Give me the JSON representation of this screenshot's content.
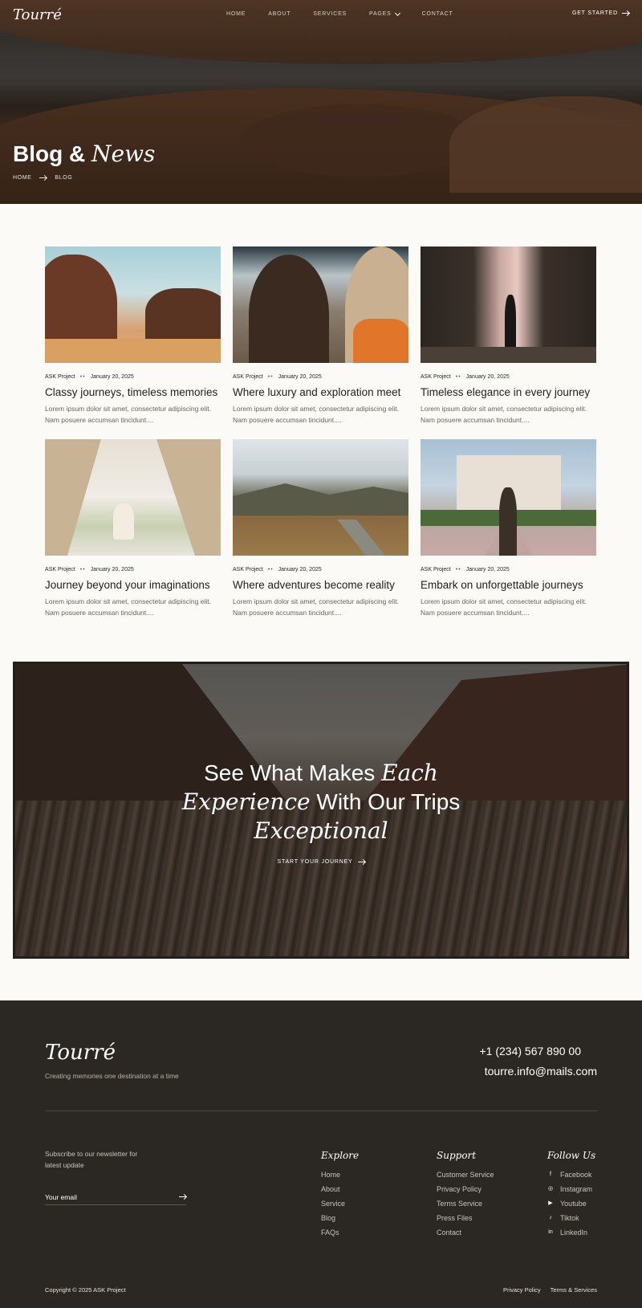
{
  "brand": {
    "logo": "Tourré"
  },
  "nav": {
    "items": [
      {
        "label": "HOME"
      },
      {
        "label": "ABOUT"
      },
      {
        "label": "SERVICES"
      },
      {
        "label": "PAGES"
      },
      {
        "label": "CONTACT"
      }
    ],
    "cta": "GET STARTED"
  },
  "hero": {
    "title_plain": "Blog &",
    "title_italic": "News",
    "breadcrumb": {
      "home": "HOME",
      "current": "BLOG"
    }
  },
  "posts": [
    {
      "author": "ASK Project",
      "date": "January 20, 2025",
      "title": "Classy journeys, timeless memories",
      "excerpt": "Lorem ipsum dolor sit amet, consectetur adipiscing elit. Nam posuere accumsan tincidunt...."
    },
    {
      "author": "ASK Project",
      "date": "January 20, 2025",
      "title": "Where luxury and exploration meet",
      "excerpt": "Lorem ipsum dolor sit amet, consectetur adipiscing elit. Nam posuere accumsan tincidunt...."
    },
    {
      "author": "ASK Project",
      "date": "January 20, 2025",
      "title": "Timeless elegance in every journey",
      "excerpt": "Lorem ipsum dolor sit amet, consectetur adipiscing elit. Nam posuere accumsan tincidunt...."
    },
    {
      "author": "ASK Project",
      "date": "January 20, 2025",
      "title": "Journey beyond your imaginations",
      "excerpt": "Lorem ipsum dolor sit amet, consectetur adipiscing elit. Nam posuere accumsan tincidunt...."
    },
    {
      "author": "ASK Project",
      "date": "January 20, 2025",
      "title": "Where adventures become reality",
      "excerpt": "Lorem ipsum dolor sit amet, consectetur adipiscing elit. Nam posuere accumsan tincidunt...."
    },
    {
      "author": "ASK Project",
      "date": "January 20, 2025",
      "title": "Embark on unforgettable journeys",
      "excerpt": "Lorem ipsum dolor sit amet, consectetur adipiscing elit. Nam posuere accumsan tincidunt...."
    }
  ],
  "cta": {
    "line1_plain": "See What Makes",
    "line1_italic": "Each",
    "line2_italic": "Experience",
    "line2_plain": "With Our Trips",
    "line3_italic": "Exceptional",
    "button": "START YOUR JOURNEY"
  },
  "footer": {
    "logo": "Tourré",
    "tagline": "Creating memories one destination at a time",
    "phone": "+1 (234) 567 890 00",
    "email": "tourre.info@mails.com",
    "newsletter_text": "Subscribe to our newsletter for latest update",
    "email_placeholder": "Your email",
    "explore": {
      "title": "Explore",
      "links": [
        "Home",
        "About",
        "Service",
        "Blog",
        "FAQs"
      ]
    },
    "support": {
      "title": "Support",
      "links": [
        "Customer Service",
        "Privacy Policy",
        "Terms Service",
        "Press Files",
        "Contact"
      ]
    },
    "follow": {
      "title": "Follow Us",
      "links": [
        {
          "label": "Facebook",
          "icon": "facebook-icon",
          "glyph": "f"
        },
        {
          "label": "Instagram",
          "icon": "instagram-icon",
          "glyph": "◎"
        },
        {
          "label": "Youtube",
          "icon": "youtube-icon",
          "glyph": "▶"
        },
        {
          "label": "Tiktok",
          "icon": "tiktok-icon",
          "glyph": "♪"
        },
        {
          "label": "LinkedIn",
          "icon": "linkedin-icon",
          "glyph": "in"
        }
      ]
    },
    "copyright": "Copyright © 2025 ASK Project",
    "legal": [
      "Privacy Policy",
      "Terms & Services"
    ]
  }
}
